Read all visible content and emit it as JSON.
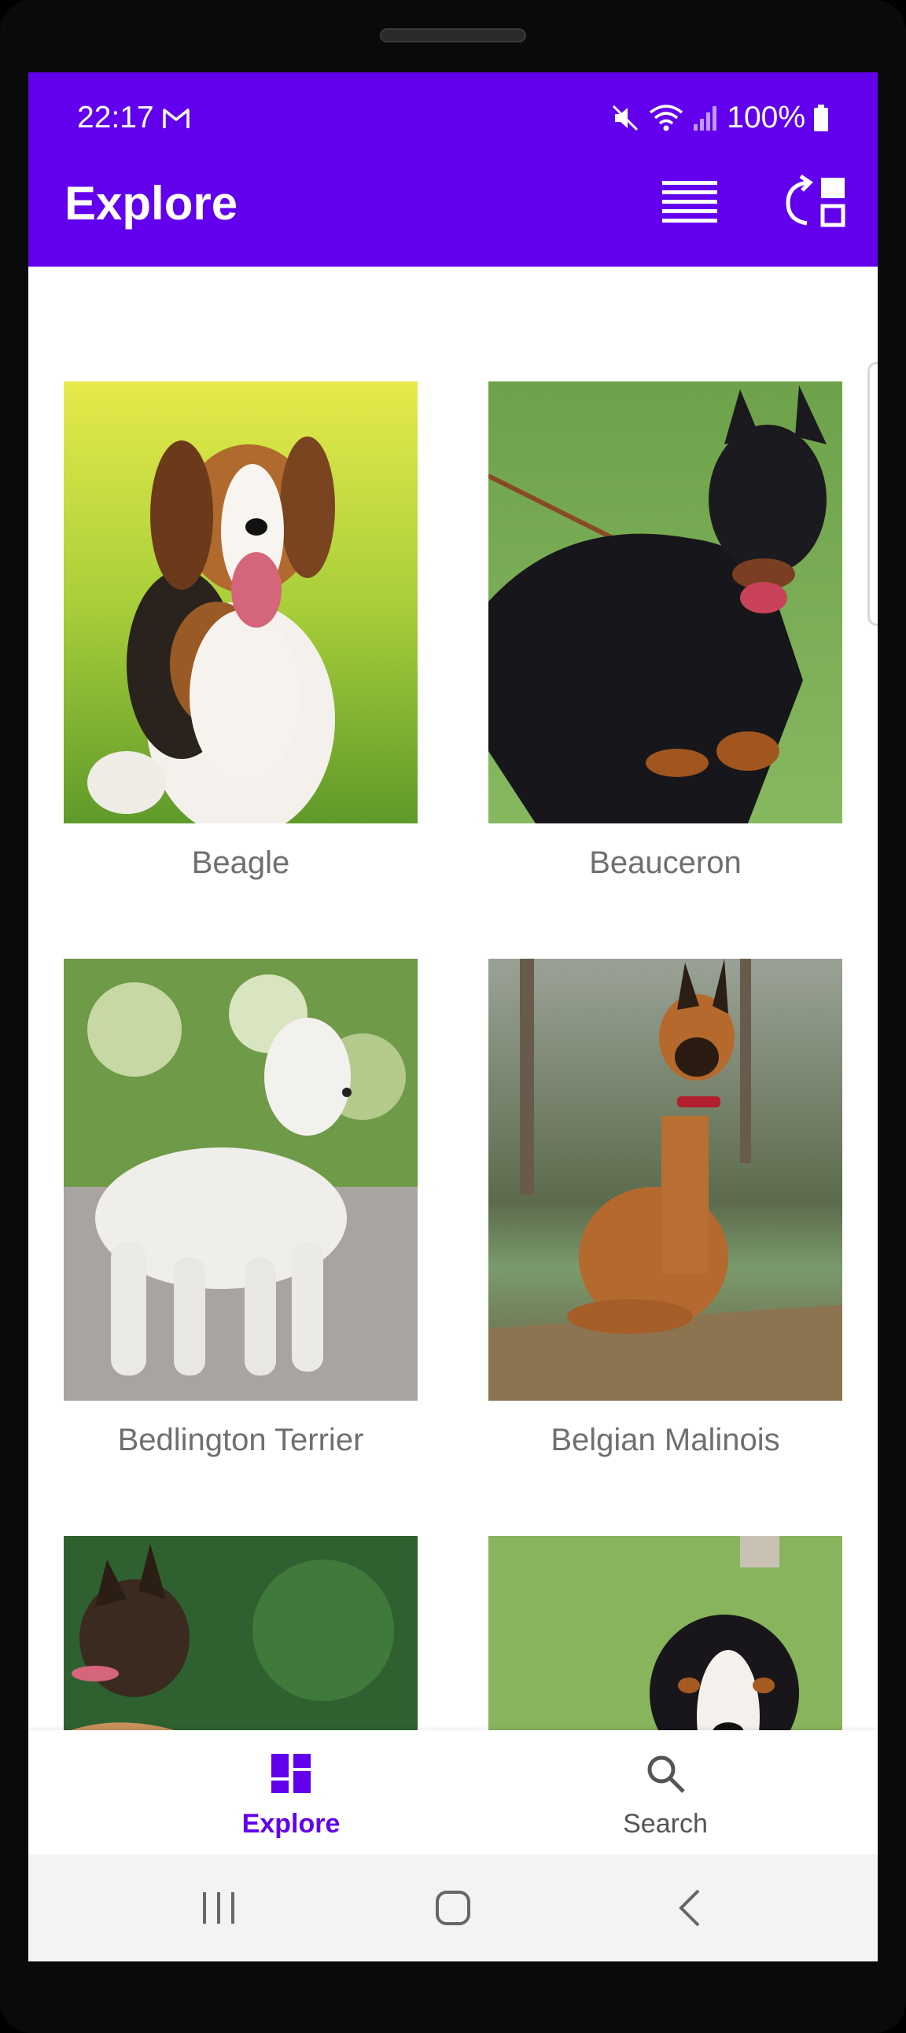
{
  "status": {
    "time": "22:17",
    "battery": "100%"
  },
  "header": {
    "title": "Explore"
  },
  "breeds": [
    {
      "name": "Beagle"
    },
    {
      "name": "Beauceron"
    },
    {
      "name": "Bedlington Terrier"
    },
    {
      "name": "Belgian Malinois"
    },
    {
      "name": ""
    },
    {
      "name": ""
    }
  ],
  "nav": {
    "explore_label": "Explore",
    "search_label": "Search",
    "active_color": "#6200ee",
    "inactive_color": "#555555"
  },
  "colors": {
    "appbar": "#6200ee"
  },
  "icons": [
    "gmail-icon",
    "mute-icon",
    "wifi-icon",
    "signal-icon",
    "battery-icon",
    "menu-icon",
    "swap-layout-icon",
    "dashboard-icon",
    "search-icon",
    "recents-icon",
    "home-icon",
    "back-icon"
  ]
}
